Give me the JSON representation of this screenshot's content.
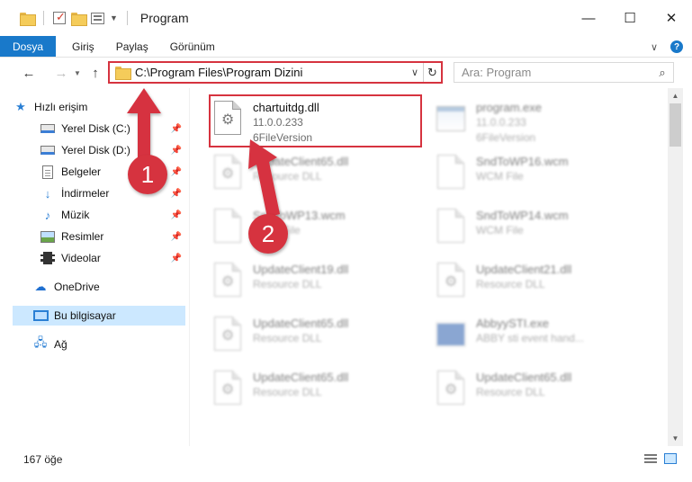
{
  "window": {
    "title": "Program",
    "minimize": "—",
    "maximize": "☐",
    "close": "✕"
  },
  "ribbon": {
    "tabs": [
      "Dosya",
      "Giriş",
      "Paylaş",
      "Görünüm"
    ]
  },
  "address": {
    "path": "C:\\Program Files\\Program Dizini"
  },
  "search": {
    "placeholder": "Ara: Program"
  },
  "nav": {
    "quick_access": "Hızlı erişim",
    "items": [
      {
        "label": "Yerel Disk (C:)"
      },
      {
        "label": "Yerel Disk (D:)"
      },
      {
        "label": "Belgeler"
      },
      {
        "label": "İndirmeler"
      },
      {
        "label": "Müzik"
      },
      {
        "label": "Resimler"
      },
      {
        "label": "Videolar"
      }
    ],
    "onedrive": "OneDrive",
    "this_pc": "Bu bilgisayar",
    "network": "Ağ"
  },
  "files": [
    {
      "name": "chartuitdg.dll",
      "line2": "11.0.0.233",
      "line3": "6FileVersion",
      "icon": "dll-gear-icon"
    },
    {
      "name": "program.exe",
      "line2": "11.0.0.233",
      "line3": "6FileVersion",
      "icon": "exe-icon"
    },
    {
      "name": "UpdateClient65.dll",
      "line2": "Resource DLL",
      "icon": "dll-gear-icon"
    },
    {
      "name": "SndToWP16.wcm",
      "line2": "WCM File",
      "icon": "file-icon"
    },
    {
      "name": "SndToWP13.wcm",
      "line2": "WCM File",
      "icon": "file-icon"
    },
    {
      "name": "SndToWP14.wcm",
      "line2": "WCM File",
      "icon": "file-icon"
    },
    {
      "name": "UpdateClient19.dll",
      "line2": "Resource DLL",
      "icon": "dll-gear-icon"
    },
    {
      "name": "UpdateClient21.dll",
      "line2": "Resource DLL",
      "icon": "dll-gear-icon"
    },
    {
      "name": "UpdateClient65.dll",
      "line2": "Resource DLL",
      "icon": "dll-gear-icon"
    },
    {
      "name": "AbbyySTI.exe",
      "line2": "ABBY sti event hand...",
      "icon": "app-icon"
    },
    {
      "name": "UpdateClient65.dll",
      "line2": "Resource DLL",
      "icon": "dll-gear-icon"
    },
    {
      "name": "UpdateClient65.dll",
      "line2": "Resource DLL",
      "icon": "dll-gear-icon"
    }
  ],
  "status": {
    "count": "167 öğe"
  },
  "annotations": {
    "marker1": "1",
    "marker2": "2",
    "color": "#d6333f"
  }
}
